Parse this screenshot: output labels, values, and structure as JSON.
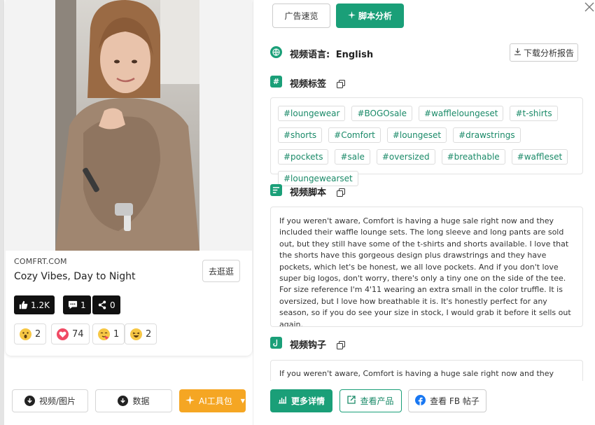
{
  "post": {
    "domain": "COMFRT.COM",
    "title": "Cozy Vibes, Day to Night",
    "visit_label": "去逛逛",
    "stats": {
      "likes": "1.2K",
      "comments": "1",
      "shares": "0"
    },
    "reactions": [
      {
        "type": "wow",
        "count": "2"
      },
      {
        "type": "love",
        "count": "74"
      },
      {
        "type": "care",
        "count": "1"
      },
      {
        "type": "haha",
        "count": "2"
      }
    ]
  },
  "left_footer": {
    "video_label": "视频/图片",
    "data_label": "数据",
    "ai_label": "AI工具包"
  },
  "tabs": {
    "ad_overview": "广告速览",
    "script_analysis": "脚本分析"
  },
  "language": {
    "label": "视频语言:",
    "value": "English"
  },
  "download_report": "下载分析报告",
  "tags_section": {
    "title": "视频标签",
    "tags": [
      "#loungewear",
      "#BOGOsale",
      "#waffleloungeset",
      "#t-shirts",
      "#shorts",
      "#Comfort",
      "#loungeset",
      "#drawstrings",
      "#pockets",
      "#sale",
      "#oversized",
      "#breathable",
      "#waffleset",
      "#loungewearset"
    ]
  },
  "script_section": {
    "title": "视频脚本",
    "text": "If you weren't aware, Comfort is having a huge sale right now and they included their waffle lounge sets. The long sleeve and long pants are sold out, but they still have some of the t-shirts and shorts available. I love that the shorts have this gorgeous design plus drawstrings and they have pockets, which let's be honest, we all love pockets. And if you don't love super big logos, don't worry, there's only a tiny one on the side of the tee. For size reference I'm 4'11 wearing an extra small in the color truffle. It is oversized, but I love how breathable it is. It's honestly perfect for any season, so if you do see your size in stock, I would grab it before it sells out again."
  },
  "hook_section": {
    "title": "视频钩子",
    "text": "If you weren't aware, Comfort is having a huge sale right now and they included"
  },
  "footer": {
    "more_details": "更多详情",
    "view_product": "查看产品",
    "view_fb_post": "查看 FB 帖子"
  },
  "colors": {
    "accent": "#1a9f78",
    "ai_button": "#f5a623"
  }
}
